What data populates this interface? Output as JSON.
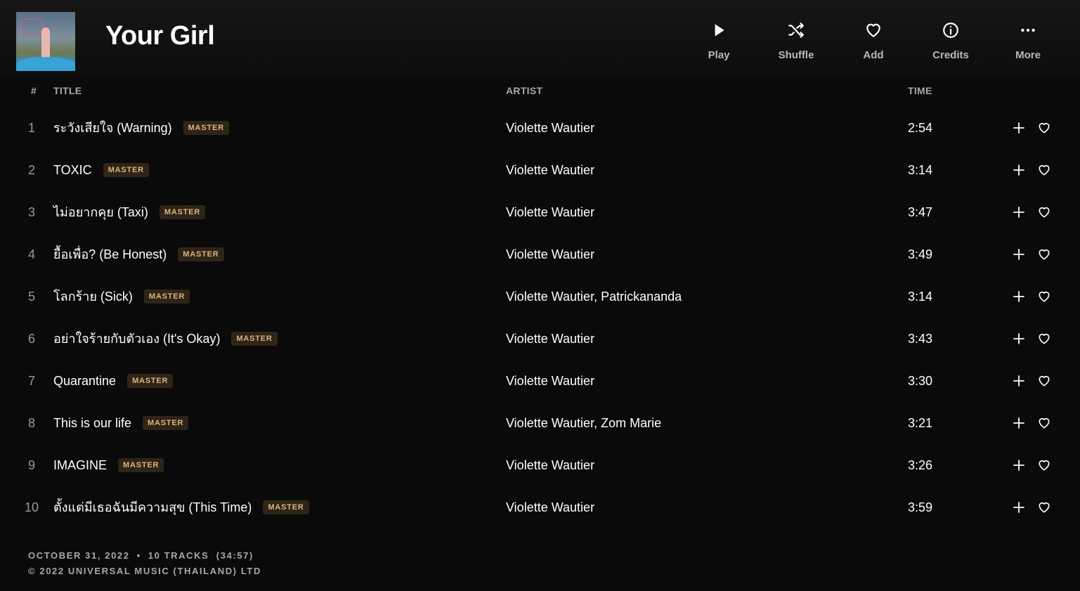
{
  "album": {
    "title": "Your Girl"
  },
  "actions": [
    {
      "label": "Play",
      "icon": "play-icon"
    },
    {
      "label": "Shuffle",
      "icon": "shuffle-icon"
    },
    {
      "label": "Add",
      "icon": "heart-icon"
    },
    {
      "label": "Credits",
      "icon": "info-icon"
    },
    {
      "label": "More",
      "icon": "more-icon"
    }
  ],
  "columns": {
    "num": "#",
    "title": "TITLE",
    "artist": "ARTIST",
    "time": "TIME"
  },
  "badge_label": "MASTER",
  "tracks": [
    {
      "num": "1",
      "title": "ระวังเสียใจ (Warning)",
      "artist": "Violette Wautier",
      "time": "2:54"
    },
    {
      "num": "2",
      "title": "TOXIC",
      "artist": "Violette Wautier",
      "time": "3:14"
    },
    {
      "num": "3",
      "title": "ไม่อยากคุย (Taxi)",
      "artist": "Violette Wautier",
      "time": "3:47"
    },
    {
      "num": "4",
      "title": "ยื้อเพื่อ? (Be Honest)",
      "artist": "Violette Wautier",
      "time": "3:49"
    },
    {
      "num": "5",
      "title": "โลกร้าย (Sick)",
      "artist": "Violette Wautier, Patrickananda",
      "time": "3:14"
    },
    {
      "num": "6",
      "title": "อย่าใจร้ายกับตัวเอง (It's Okay)",
      "artist": "Violette Wautier",
      "time": "3:43"
    },
    {
      "num": "7",
      "title": "Quarantine",
      "artist": "Violette Wautier",
      "time": "3:30"
    },
    {
      "num": "8",
      "title": "This is our life",
      "artist": "Violette Wautier, Zom Marie",
      "time": "3:21"
    },
    {
      "num": "9",
      "title": "IMAGINE",
      "artist": "Violette Wautier",
      "time": "3:26"
    },
    {
      "num": "10",
      "title": "ตั้งแต่มีเธอฉันมีความสุข (This Time)",
      "artist": "Violette Wautier",
      "time": "3:59"
    }
  ],
  "footer": {
    "date": "OCTOBER 31, 2022",
    "separator": "•",
    "tracks": "10 TRACKS  (34:57)",
    "copyright": "© 2022 UNIVERSAL MUSIC (THAILAND) LTD"
  },
  "colors": {
    "background": "#0a0a0a",
    "badge_text": "#e0b47a",
    "badge_bg": "#2e2518",
    "muted": "#a8a8a8"
  }
}
